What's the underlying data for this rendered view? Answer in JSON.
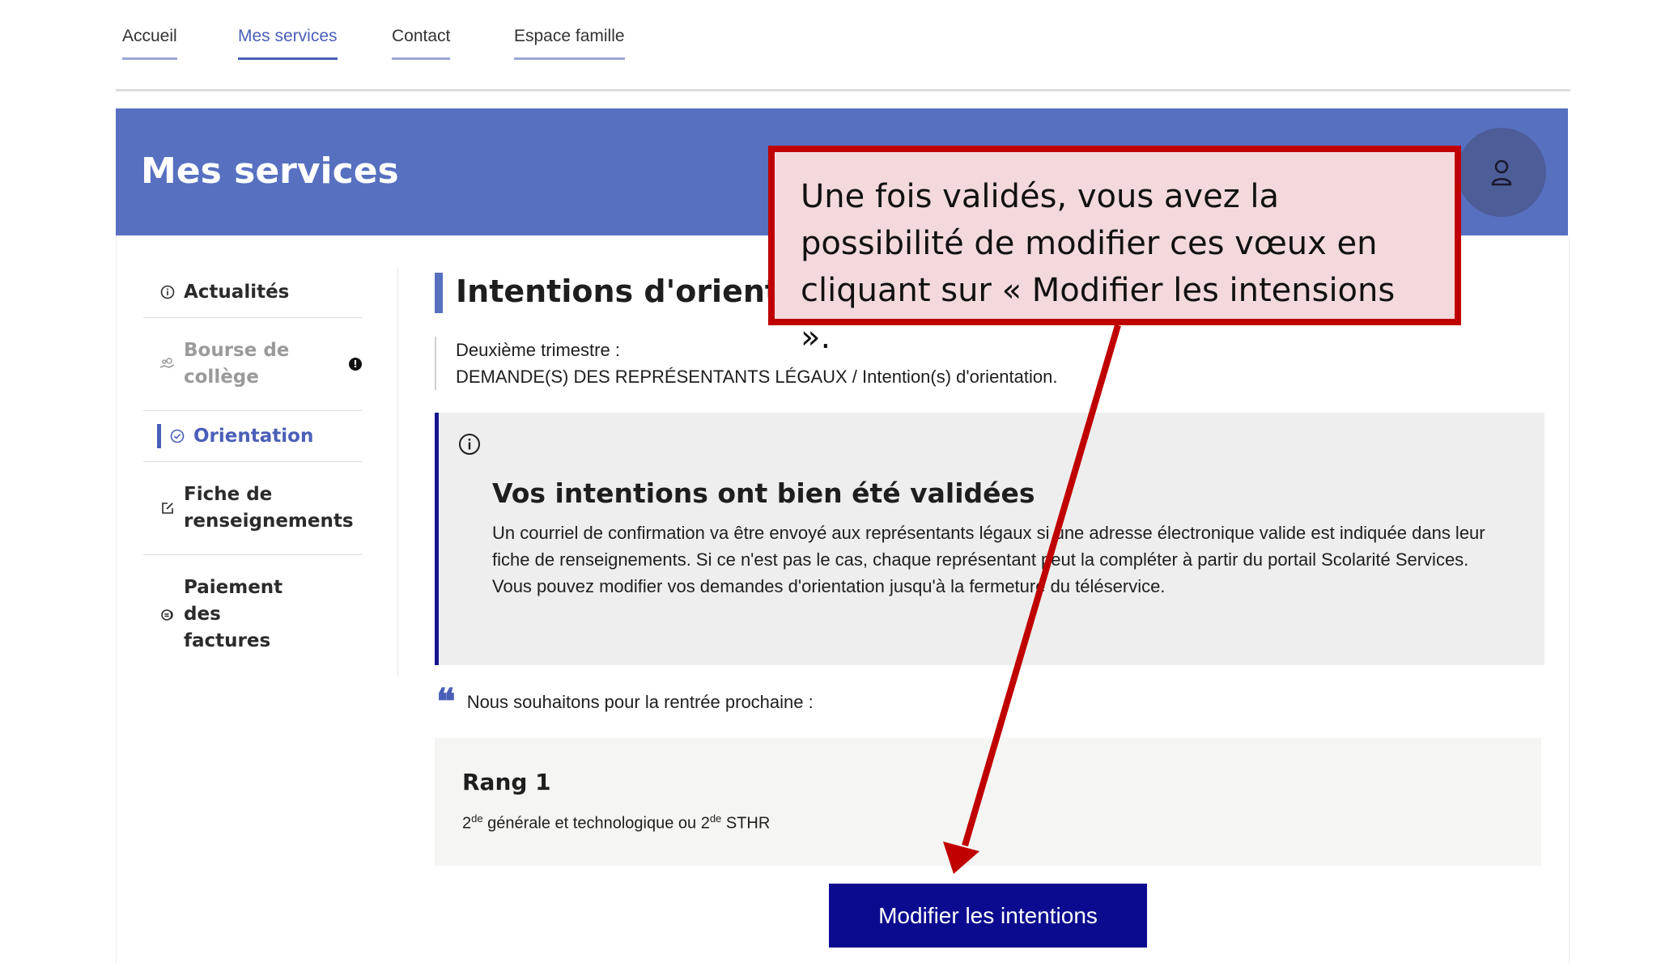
{
  "topnav": {
    "items": [
      {
        "label": "Accueil",
        "active": false
      },
      {
        "label": "Mes services",
        "active": true
      },
      {
        "label": "Contact",
        "active": false
      },
      {
        "label": "Espace famille",
        "active": false
      }
    ]
  },
  "header": {
    "title": "Mes services",
    "avatar_icon": "user-icon"
  },
  "sidebar": {
    "items": [
      {
        "label": "Actualités",
        "icon": "info-icon",
        "state": "normal"
      },
      {
        "label": "Bourse de collège",
        "icon": "hand-coins-icon",
        "state": "disabled",
        "badge": "!"
      },
      {
        "label": "Orientation",
        "icon": "check-circle-icon",
        "state": "active"
      },
      {
        "label": "Fiche de renseignements",
        "icon": "edit-icon",
        "state": "normal"
      },
      {
        "label": "Paiement des factures",
        "icon": "coins-icon",
        "state": "normal"
      }
    ]
  },
  "main": {
    "section_title": "Intentions d'orientation",
    "trimester": "Deuxième trimestre :",
    "breadcrumb": "DEMANDE(S) DES REPRÉSENTANTS LÉGAUX / Intention(s) d'orientation.",
    "alert": {
      "icon": "info-icon",
      "title": "Vos intentions ont bien été validées",
      "body_1": "Un courriel de confirmation va être envoyé aux représentants légaux si une adresse électronique valide est indiquée dans leur fiche de renseignements. Si ce n'est pas le cas, chaque représentant peut la compléter à partir du portail Scolarité Services.",
      "body_2": "Vous pouvez modifier vos demandes d'orientation jusqu'à la fermeture du téléservice."
    },
    "quote_mark": "❝",
    "quote": "Nous souhaitons pour la rentrée prochaine :",
    "rank": {
      "title": "Rang 1",
      "part1": "2",
      "sup1": "de",
      "part2": " générale et technologique ou 2",
      "sup2": "de",
      "part3": " STHR"
    },
    "modify_button": "Modifier les intentions"
  },
  "annotation": {
    "text": "Une fois validés, vous avez la possibilité de modifier ces vœux en cliquant sur « Modifier les intensions ».",
    "color": "#c00000"
  }
}
